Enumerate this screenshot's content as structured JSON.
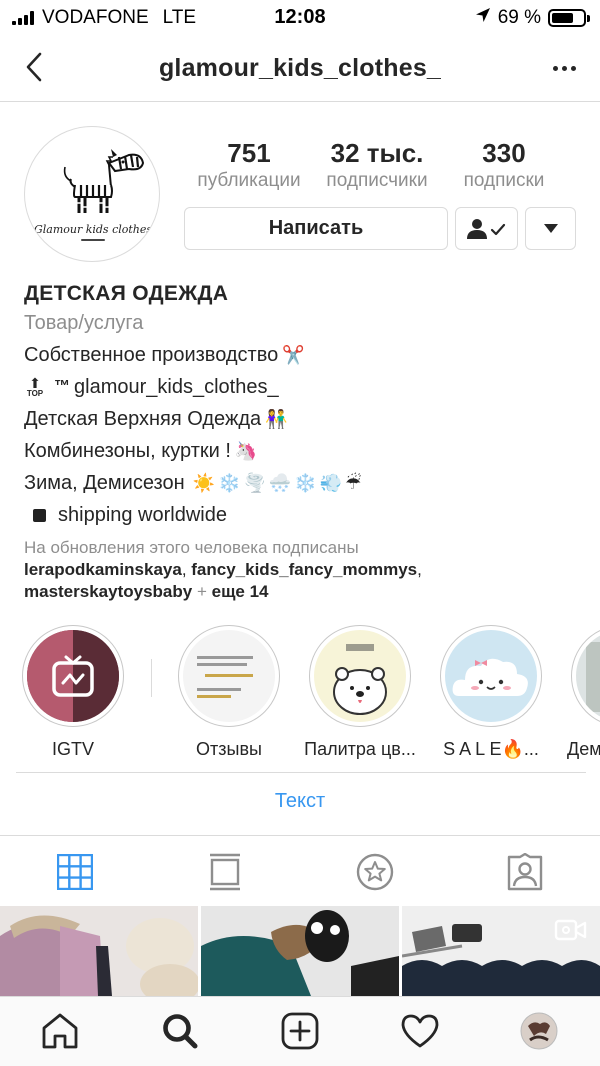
{
  "status_bar": {
    "carrier": "VODAFONE",
    "network": "LTE",
    "time": "12:08",
    "battery_percent": "69 %",
    "battery_level": 0.69
  },
  "header": {
    "username": "glamour_kids_clothes_"
  },
  "profile": {
    "avatar_brand": "Glamour kids clothes",
    "stats": [
      {
        "value": "751",
        "label": "публикации"
      },
      {
        "value": "32 тыс.",
        "label": "подписчики"
      },
      {
        "value": "330",
        "label": "подписки"
      }
    ],
    "message_button": "Написать",
    "following_icon": "person-check-icon",
    "dropdown_icon": "caret-down-icon"
  },
  "bio": {
    "name": "ДЕТСКАЯ ОДЕЖДА",
    "category": "Товар/услуга",
    "line1": "Собственное производство",
    "line1_emoji": "✂️",
    "line2_prefix": "™",
    "line2": "glamour_kids_clothes_",
    "line3": "Детская Верхняя Одежда",
    "line3_emoji": "👫",
    "line4": "Комбинезоны, куртки !",
    "line4_emoji": "🦄",
    "line5": "Зима, Демисезон",
    "line5_emoji": "☀️❄️🌪️🌨️❄️💨☔",
    "line6": "shipping worldwide",
    "followed_by_text": "На обновления этого человека подписаны",
    "followed_user1": "lerapodkaminskaya",
    "followed_user2": "fancy_kids_fancy_mommys",
    "followed_user3": "masterskaytoysbaby",
    "followed_plus": "+",
    "followed_more": "еще 14"
  },
  "highlights": [
    {
      "label": "IGTV"
    },
    {
      "label": "Отзывы"
    },
    {
      "label": "Палитра цв..."
    },
    {
      "label": "S A L E🔥..."
    },
    {
      "label": "Демисезон"
    }
  ],
  "text_link": "Текст",
  "tabs": [
    "grid-icon",
    "feed-icon",
    "guides-icon",
    "tagged-icon"
  ],
  "bottom_nav": [
    "home-icon",
    "search-icon",
    "new-post-icon",
    "activity-icon",
    "profile-avatar"
  ],
  "colors": {
    "link": "#3897f0",
    "grid_active": "#3897f0",
    "muted": "#8e8e8e",
    "border": "#dbdbdb"
  }
}
